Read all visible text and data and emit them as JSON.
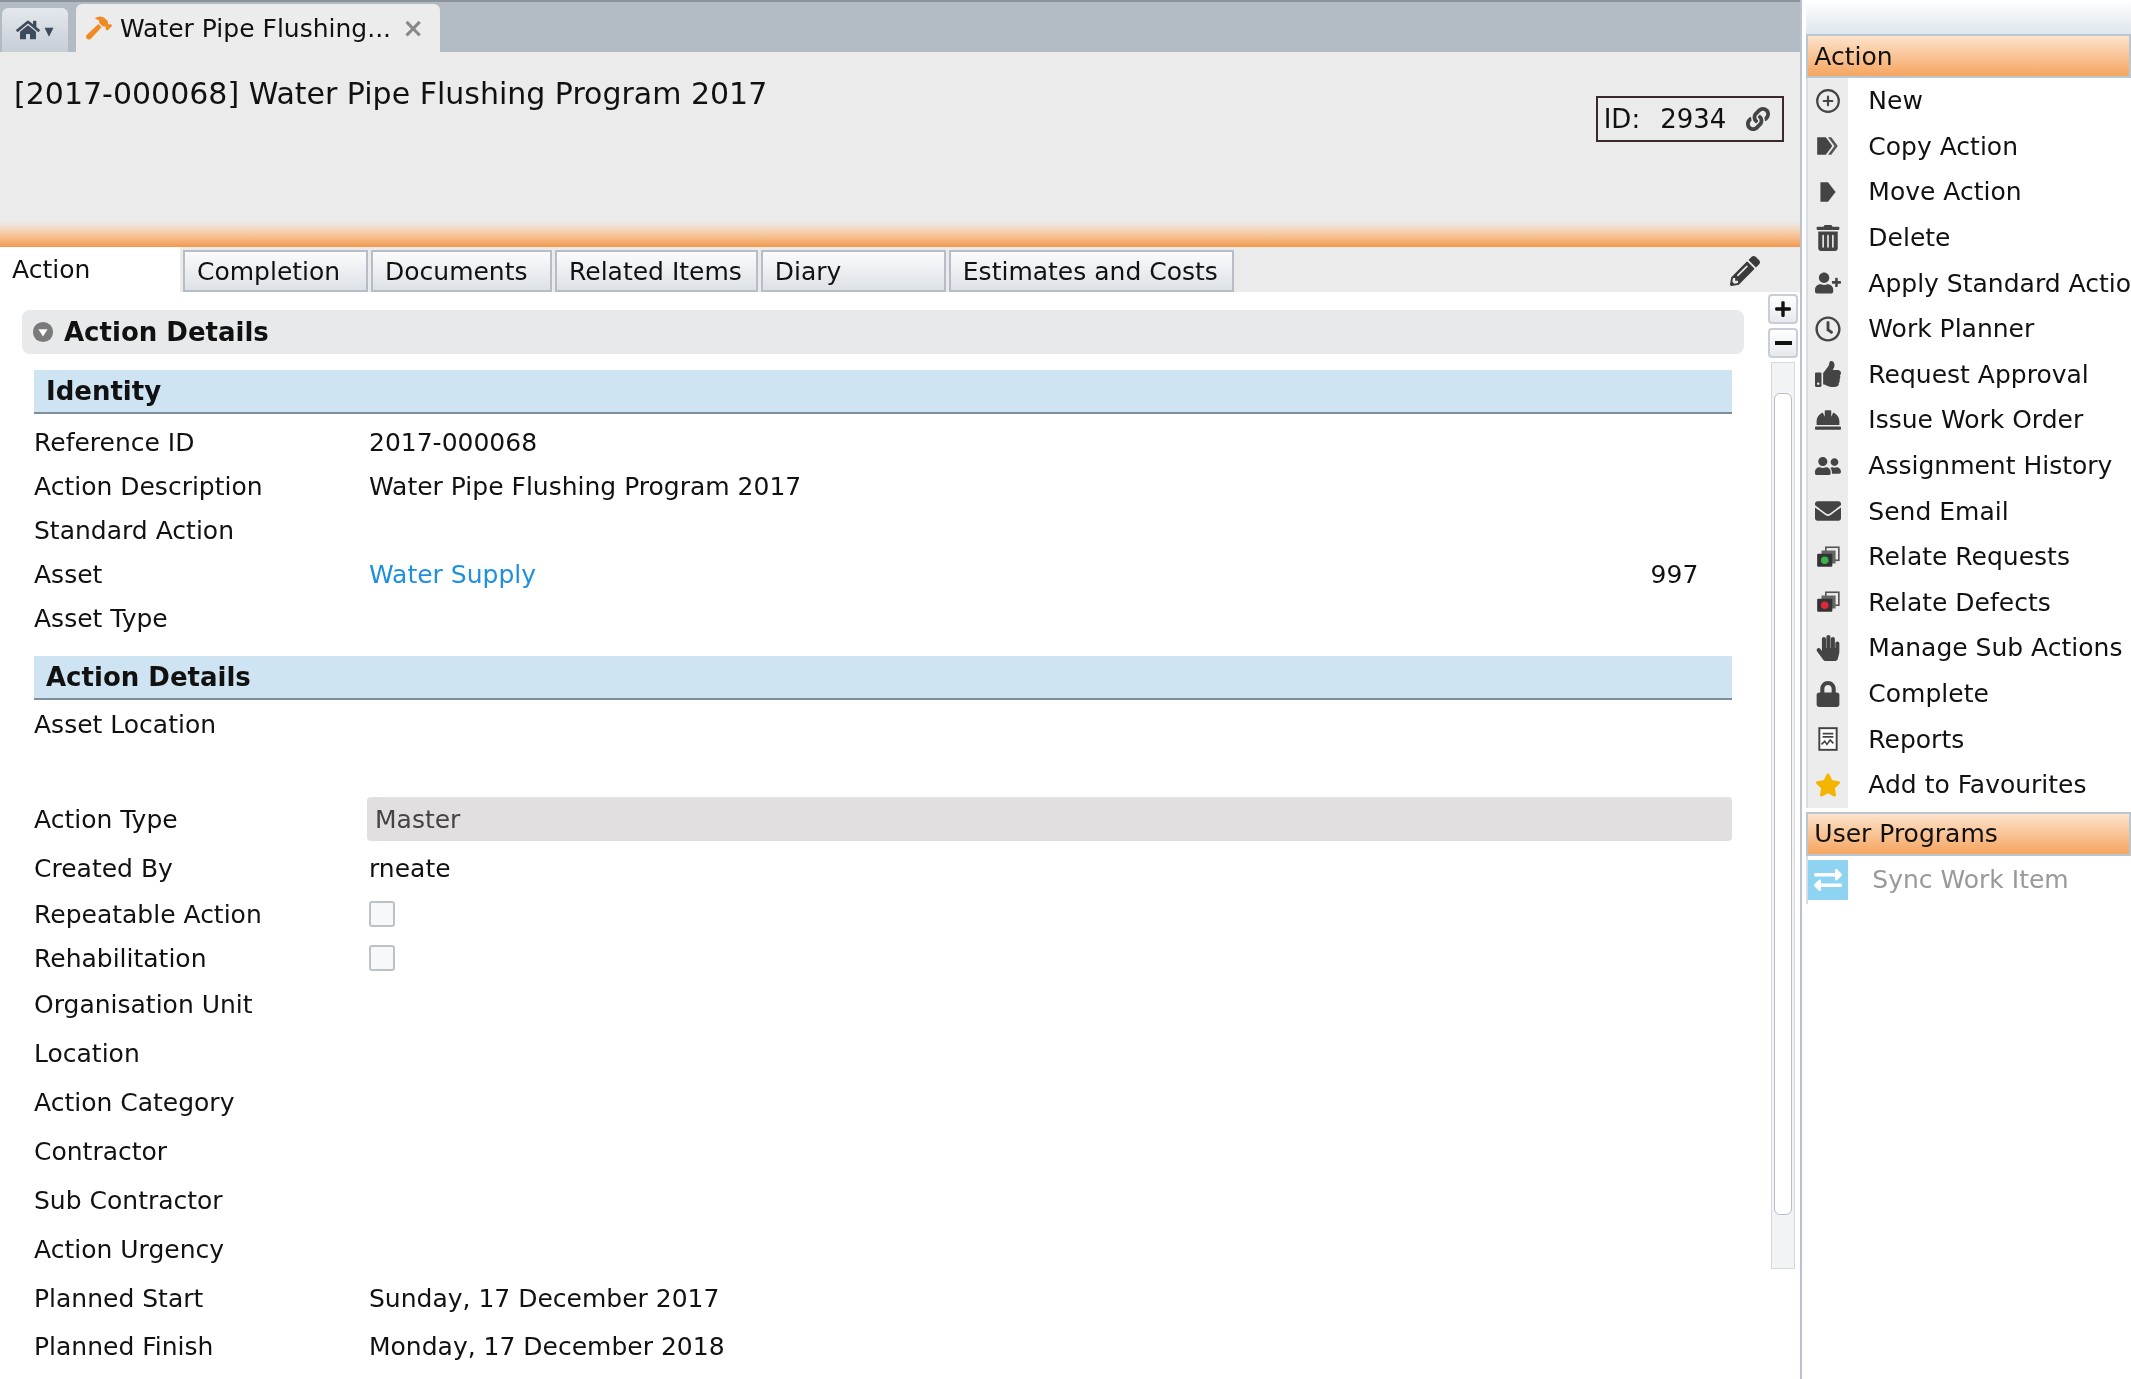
{
  "home_tab": {
    "caret": "▾"
  },
  "doc_tab": {
    "title": "Water Pipe Flushing...",
    "close": "×",
    "selected": true
  },
  "header": {
    "title": "[2017-000068] Water Pipe Flushing Program 2017",
    "id_label": "ID:",
    "id_value": "2934"
  },
  "tabs": [
    {
      "label": "Action",
      "selected": true
    },
    {
      "label": "Completion",
      "selected": false
    },
    {
      "label": "Documents",
      "selected": false
    },
    {
      "label": "Related Items",
      "selected": false
    },
    {
      "label": "Diary",
      "selected": false
    },
    {
      "label": "Estimates and Costs",
      "selected": false
    }
  ],
  "section": {
    "title": "Action Details",
    "expanded": true
  },
  "groups": [
    {
      "title": "Identity",
      "fields": [
        {
          "label": "Reference ID",
          "kind": "text",
          "value": "2017-000068"
        },
        {
          "label": "Action Description",
          "kind": "text",
          "value": "Water Pipe Flushing Program 2017"
        },
        {
          "label": "Standard Action",
          "kind": "text"
        },
        {
          "label": "Asset",
          "kind": "link",
          "value": "Water Supply",
          "extra": "997"
        },
        {
          "label": "Asset Type",
          "kind": "text"
        }
      ]
    },
    {
      "title": "Action Details",
      "fields": [
        {
          "label": "Asset Location",
          "kind": "area"
        },
        {
          "label": "Action Type",
          "kind": "select",
          "value": "Master"
        },
        {
          "label": "Created By",
          "kind": "text",
          "value": "rneate"
        },
        {
          "label": "Repeatable Action",
          "kind": "checkbox",
          "checked": false
        },
        {
          "label": "Rehabilitation",
          "kind": "checkbox",
          "checked": false
        },
        {
          "label": "Organisation Unit",
          "kind": "text"
        },
        {
          "label": "Location",
          "kind": "text"
        },
        {
          "label": "Action Category",
          "kind": "text"
        },
        {
          "label": "Contractor",
          "kind": "text"
        },
        {
          "label": "Sub Contractor",
          "kind": "text"
        },
        {
          "label": "Action Urgency",
          "kind": "text"
        },
        {
          "label": "Planned Start",
          "kind": "text",
          "value": "Sunday, 17 December 2017"
        },
        {
          "label": "Planned Finish",
          "kind": "text",
          "value": "Monday, 17 December 2018"
        }
      ]
    }
  ],
  "action_panel": {
    "title": "Action",
    "items": [
      {
        "label": "New",
        "disabled": false
      },
      {
        "label": "Copy Action",
        "disabled": false
      },
      {
        "label": "Move Action",
        "disabled": false
      },
      {
        "label": "Delete",
        "disabled": false
      },
      {
        "label": "Apply Standard Actio",
        "disabled": false
      },
      {
        "label": "Work Planner",
        "disabled": false
      },
      {
        "label": "Request Approval",
        "disabled": false
      },
      {
        "label": "Issue Work Order",
        "disabled": false
      },
      {
        "label": "Assignment History",
        "disabled": false
      },
      {
        "label": "Send Email",
        "disabled": false
      },
      {
        "label": "Relate Requests",
        "disabled": false
      },
      {
        "label": "Relate Defects",
        "disabled": false
      },
      {
        "label": "Manage Sub Actions",
        "disabled": false
      },
      {
        "label": "Complete",
        "disabled": false
      },
      {
        "label": "Reports",
        "disabled": false
      },
      {
        "label": "Add to Favourites",
        "disabled": false
      }
    ]
  },
  "user_programs": {
    "title": "User Programs",
    "items": [
      {
        "label": "Sync Work Item",
        "disabled": true
      }
    ]
  }
}
